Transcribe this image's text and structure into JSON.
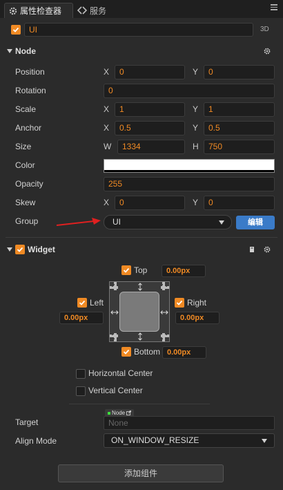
{
  "tabs": [
    {
      "label": "属性检查器",
      "icon": "gear-icon"
    },
    {
      "label": "服务",
      "icon": "service-icon"
    }
  ],
  "node": {
    "enabled": true,
    "name": "UI",
    "mode_tag": "3D"
  },
  "node_section": {
    "title": "Node",
    "properties": {
      "position": {
        "label": "Position",
        "x_axis": "X",
        "x": "0",
        "y_axis": "Y",
        "y": "0"
      },
      "rotation": {
        "label": "Rotation",
        "value": "0"
      },
      "scale": {
        "label": "Scale",
        "x_axis": "X",
        "x": "1",
        "y_axis": "Y",
        "y": "1"
      },
      "anchor": {
        "label": "Anchor",
        "x_axis": "X",
        "x": "0.5",
        "y_axis": "Y",
        "y": "0.5"
      },
      "size": {
        "label": "Size",
        "w_axis": "W",
        "w": "1334",
        "h_axis": "H",
        "h": "750"
      },
      "color": {
        "label": "Color",
        "value": "#ffffff"
      },
      "opacity": {
        "label": "Opacity",
        "value": "255"
      },
      "skew": {
        "label": "Skew",
        "x_axis": "X",
        "x": "0",
        "y_axis": "Y",
        "y": "0"
      },
      "group": {
        "label": "Group",
        "value": "UI",
        "edit_label": "编辑"
      }
    }
  },
  "widget_section": {
    "title": "Widget",
    "enabled": true,
    "top": {
      "label": "Top",
      "checked": true,
      "value": "0.00px"
    },
    "left": {
      "label": "Left",
      "checked": true,
      "value": "0.00px"
    },
    "right": {
      "label": "Right",
      "checked": true,
      "value": "0.00px"
    },
    "bottom": {
      "label": "Bottom",
      "checked": true,
      "value": "0.00px"
    },
    "horizontal_center": {
      "label": "Horizontal Center",
      "checked": false
    },
    "vertical_center": {
      "label": "Vertical Center",
      "checked": false
    },
    "target": {
      "label": "Target",
      "type_tag": "Node",
      "placeholder": "None"
    },
    "align_mode": {
      "label": "Align Mode",
      "value": "ON_WINDOW_RESIZE"
    }
  },
  "add_component_label": "添加组件",
  "colors": {
    "accent": "#f08a24",
    "edit_button": "#3a7bc8",
    "annotation_arrow": "#e02020"
  }
}
